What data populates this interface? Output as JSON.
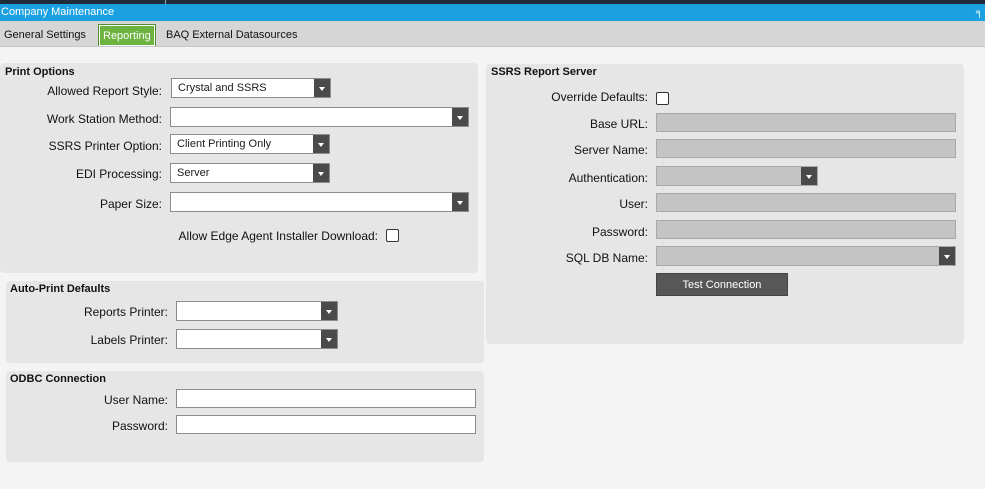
{
  "window": {
    "title": "Company Maintenance",
    "pin_glyph": "╕"
  },
  "tabs": [
    {
      "label": "General Settings"
    },
    {
      "label": "Reporting"
    },
    {
      "label": "BAQ External Datasources"
    }
  ],
  "print_options": {
    "title": "Print Options",
    "allowed_report_style": {
      "label": "Allowed Report Style:",
      "value": "Crystal and SSRS"
    },
    "work_station_method": {
      "label": "Work Station Method:",
      "value": ""
    },
    "ssrs_printer_option": {
      "label": "SSRS Printer Option:",
      "value": "Client Printing Only"
    },
    "edi_processing": {
      "label": "EDI Processing:",
      "value": "Server"
    },
    "paper_size": {
      "label": "Paper Size:",
      "value": ""
    },
    "allow_edge_agent": {
      "label": "Allow Edge Agent Installer Download:",
      "checked": false
    }
  },
  "auto_print": {
    "title": "Auto-Print Defaults",
    "reports_printer": {
      "label": "Reports Printer:",
      "value": ""
    },
    "labels_printer": {
      "label": "Labels Printer:",
      "value": ""
    }
  },
  "odbc": {
    "title": "ODBC Connection",
    "user_name": {
      "label": "User Name:",
      "value": ""
    },
    "password": {
      "label": "Password:",
      "value": ""
    }
  },
  "ssrs": {
    "title": "SSRS Report Server",
    "override_defaults": {
      "label": "Override Defaults:",
      "checked": false
    },
    "base_url": {
      "label": "Base URL:",
      "value": ""
    },
    "server_name": {
      "label": "Server Name:",
      "value": ""
    },
    "authentication": {
      "label": "Authentication:",
      "value": ""
    },
    "user": {
      "label": "User:",
      "value": ""
    },
    "password": {
      "label": "Password:",
      "value": ""
    },
    "sql_db_name": {
      "label": "SQL DB Name:",
      "value": ""
    },
    "test_connection_label": "Test Connection"
  }
}
